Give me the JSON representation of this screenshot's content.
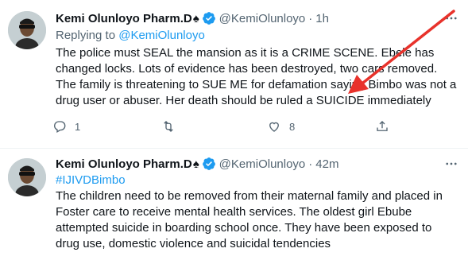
{
  "tweets": [
    {
      "author_name": "Kemi Olunloyo Pharm.D",
      "author_badge": "♠",
      "handle": "@KemiOlunloyo",
      "time": "1h",
      "replying_prefix": "Replying to ",
      "replying_to": "@KemiOlunloyo",
      "lines": [
        "The police must SEAL the mansion as it is a CRIME SCENE. Ebele has",
        "changed locks. Lots of evidence has been destroyed, two cars removed.",
        "The family is threatening to SUE ME for defamation saying Bimbo was not a",
        "drug user or abuser. Her death should be ruled a SUICIDE immediately"
      ],
      "reply_count": "1",
      "like_count": "8"
    },
    {
      "author_name": "Kemi Olunloyo Pharm.D",
      "author_badge": "♠",
      "handle": "@KemiOlunloyo",
      "time": "42m",
      "hashtag": "#IJIVDBimbo",
      "lines": [
        "The children need to be removed from their maternal family and placed in",
        "Foster care to receive mental health services. The oldest girl Ebube",
        "attempted suicide in boarding school once. They have been exposed to",
        "drug use,  domestic violence and suicidal tendencies"
      ]
    }
  ],
  "colors": {
    "accent": "#1d9bf0",
    "muted": "#536471",
    "annotation_arrow": "#e8322b"
  },
  "icons": [
    "verified-badge-icon",
    "more-icon",
    "reply-icon",
    "retweet-icon",
    "like-icon",
    "share-icon"
  ]
}
